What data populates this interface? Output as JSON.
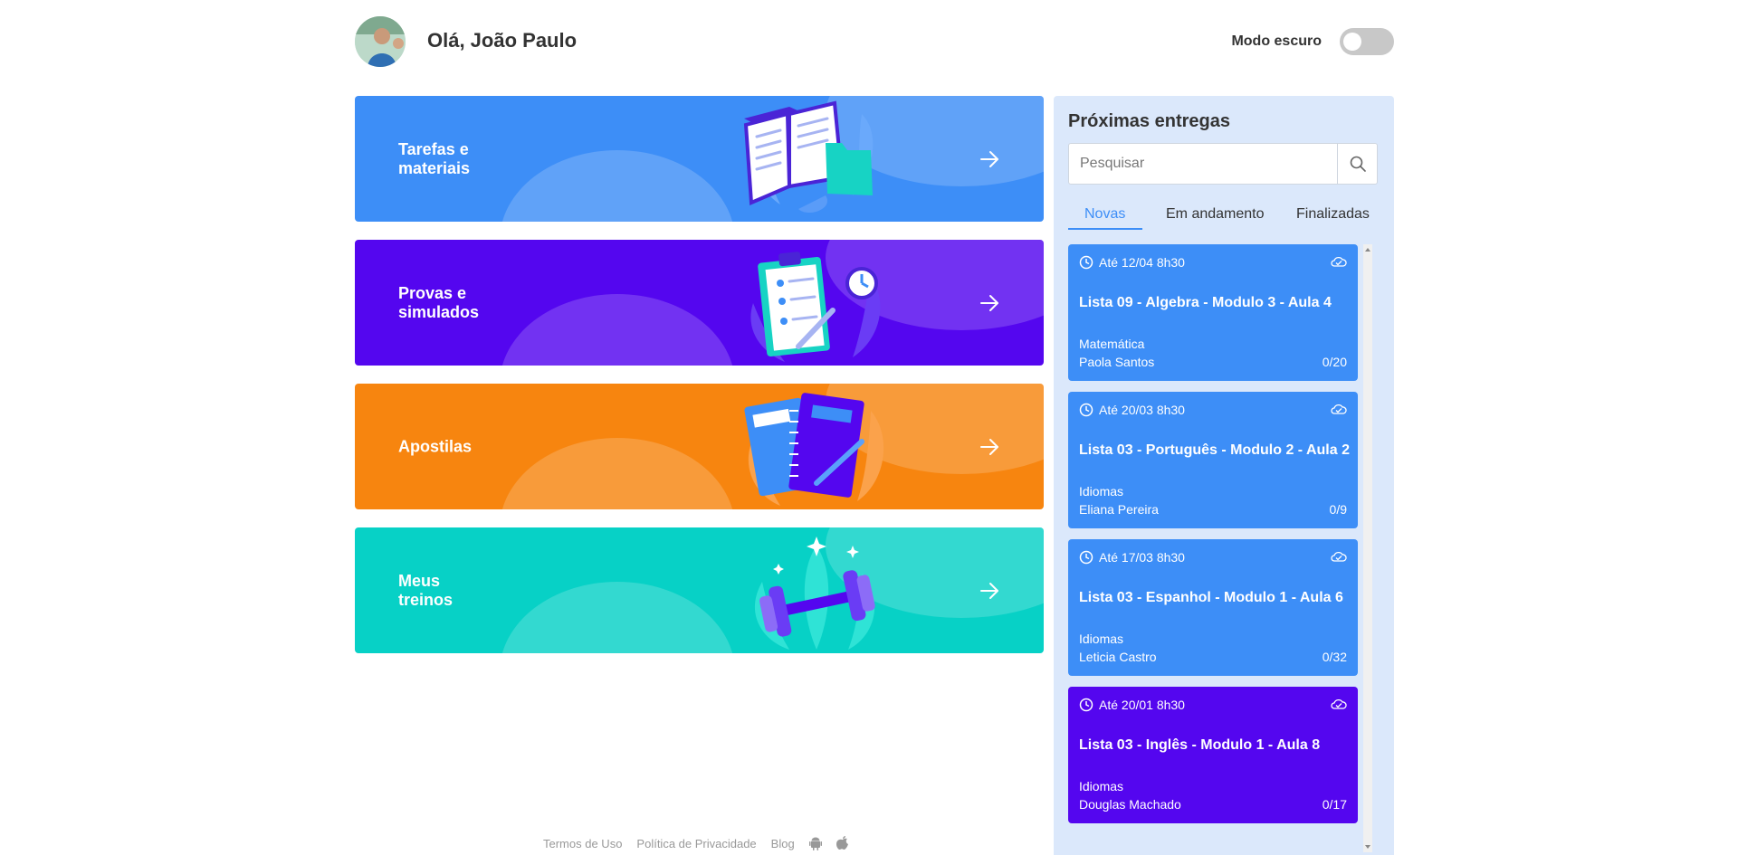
{
  "header": {
    "greeting": "Olá, João Paulo",
    "dark_mode_label": "Modo escuro",
    "dark_mode_on": false
  },
  "cards": [
    {
      "label_line1": "Tarefas e",
      "label_line2": "materiais",
      "color": "#3d8ef7",
      "icon": "open-book-icon"
    },
    {
      "label_line1": "Provas e",
      "label_line2": "simulados",
      "color": "#5406ef",
      "icon": "clipboard-checklist-icon"
    },
    {
      "label_line1": "Apostilas",
      "label_line2": "",
      "color": "#f7850f",
      "icon": "notebooks-icon"
    },
    {
      "label_line1": "Meus",
      "label_line2": "treinos",
      "color": "#07d1c6",
      "icon": "dumbbell-icon"
    }
  ],
  "footer": {
    "terms": "Termos de Uso",
    "privacy": "Política de Privacidade",
    "blog": "Blog"
  },
  "panel": {
    "title": "Próximas entregas",
    "search_placeholder": "Pesquisar",
    "tabs": [
      "Novas",
      "Em andamento",
      "Finalizadas"
    ],
    "active_tab": "Novas",
    "tasks": [
      {
        "due": "Até 12/04 8h30",
        "title": "Lista 09 - Algebra - Modulo 3 - Aula 4",
        "subject": "Matemática",
        "teacher": "Paola Santos",
        "count": "0/20",
        "color": "#3d8ef7"
      },
      {
        "due": "Até 20/03 8h30",
        "title": "Lista 03 - Português - Modulo 2 - Aula 2",
        "subject": "Idiomas",
        "teacher": "Eliana Pereira",
        "count": "0/9",
        "color": "#3d8ef7"
      },
      {
        "due": "Até 17/03 8h30",
        "title": "Lista 03 - Espanhol - Modulo 1 - Aula 6",
        "subject": "Idiomas",
        "teacher": "Leticia Castro",
        "count": "0/32",
        "color": "#3d8ef7"
      },
      {
        "due": "Até 20/01 8h30",
        "title": "Lista 03 - Inglês - Modulo 1 - Aula 8",
        "subject": "Idiomas",
        "teacher": "Douglas Machado",
        "count": "0/17",
        "color": "#5406ef"
      }
    ]
  }
}
